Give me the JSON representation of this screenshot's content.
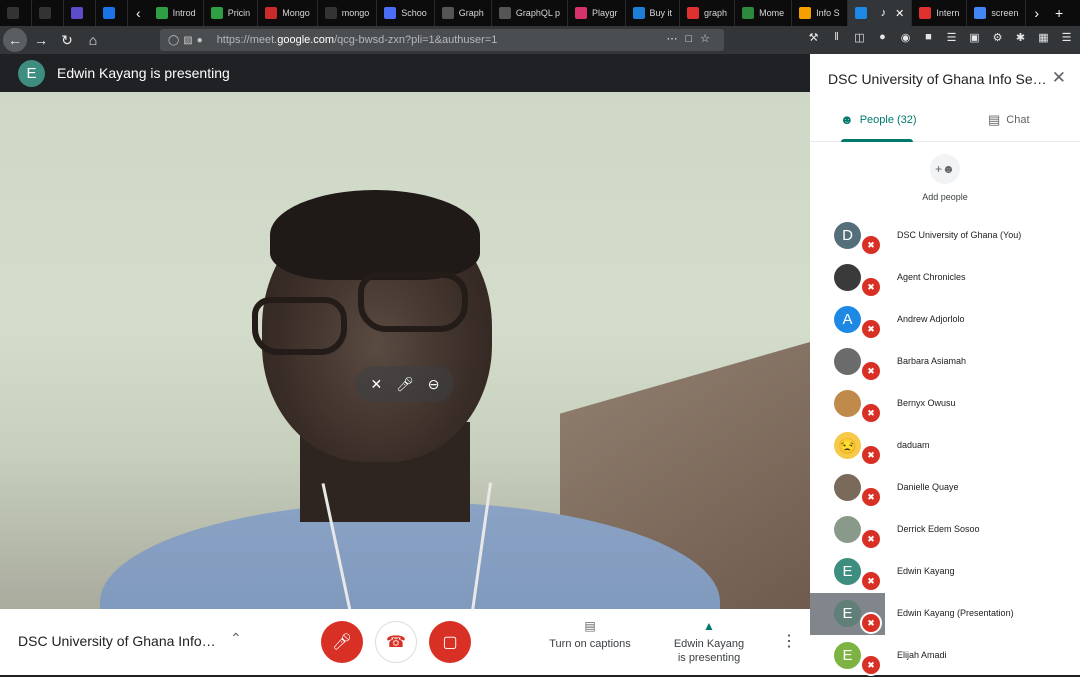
{
  "browser": {
    "tabs": [
      {
        "label": "",
        "color": "#333333",
        "icon": "github-icon"
      },
      {
        "label": "",
        "color": "#333333",
        "icon": "warning-icon"
      },
      {
        "label": "",
        "color": "#5b4dc7",
        "icon": "app-icon"
      },
      {
        "label": "",
        "color": "#1a73e8",
        "icon": "dash-icon"
      },
      {
        "label": "Introd",
        "color": "#2f9e44",
        "icon": "n-icon"
      },
      {
        "label": "Pricin",
        "color": "#2f9e44",
        "icon": "leaf-icon"
      },
      {
        "label": "Mongo",
        "color": "#c92a2a",
        "icon": "m-icon"
      },
      {
        "label": "mongo",
        "color": "#333333",
        "icon": "github-icon"
      },
      {
        "label": "Schoo",
        "color": "#4c6ef5",
        "icon": "school-icon"
      },
      {
        "label": "Graph",
        "color": "#555555",
        "icon": "prisma-icon"
      },
      {
        "label": "GraphQL p",
        "color": "#555555",
        "icon": "blank-icon"
      },
      {
        "label": "Playgr",
        "color": "#d6336c",
        "icon": "playground-icon"
      },
      {
        "label": "Buy it",
        "color": "#1c7ed6",
        "icon": "zoom-icon"
      },
      {
        "label": "graph",
        "color": "#e03131",
        "icon": "n-icon"
      },
      {
        "label": "Mome",
        "color": "#2b8a3e",
        "icon": "clock-icon"
      },
      {
        "label": "Info S",
        "color": "#f59f00",
        "icon": "mail-icon"
      },
      {
        "label": "",
        "color": "#1e88e5",
        "icon": "meet-icon"
      },
      {
        "label": "Intern",
        "color": "#e03131",
        "icon": "speed-icon"
      },
      {
        "label": "screen",
        "color": "#4285f4",
        "icon": "google-icon"
      }
    ],
    "url_prefix": "https://meet.",
    "url_host": "google.com",
    "url_path": "/qcg-bwsd-zxn?pli=1&authuser=1"
  },
  "presenter": {
    "initial": "E",
    "text": "Edwin Kayang is presenting"
  },
  "bottom": {
    "meeting_title": "DSC University of Ghana Info S...",
    "captions_label": "Turn on captions",
    "presenting_line1": "Edwin Kayang",
    "presenting_line2": "is presenting"
  },
  "panel": {
    "title": "DSC University of Ghana Info Ses...",
    "people_tab": "People (32)",
    "chat_tab": "Chat",
    "add_people": "Add people",
    "participants": [
      {
        "name": "DSC University of Ghana (You)",
        "initial": "D",
        "color": "#546e7a"
      },
      {
        "name": "Agent Chronicles",
        "initial": "",
        "color": "#3a3a3a"
      },
      {
        "name": "Andrew Adjorlolo",
        "initial": "A",
        "color": "#1e88e5"
      },
      {
        "name": "Barbara Asiamah",
        "initial": "",
        "color": "#6b6b6b"
      },
      {
        "name": "Bernyx Owusu",
        "initial": "",
        "color": "#c08a4a"
      },
      {
        "name": "daduam",
        "initial": "😒",
        "color": "#f7c948"
      },
      {
        "name": "Danielle Quaye",
        "initial": "",
        "color": "#7a6a5a"
      },
      {
        "name": "Derrick Edem Sosoo",
        "initial": "",
        "color": "#8a9a8a"
      },
      {
        "name": "Edwin Kayang",
        "initial": "E",
        "color": "#3e8e80"
      },
      {
        "name": "Edwin Kayang (Presentation)",
        "initial": "E",
        "color": "#5f7f78"
      },
      {
        "name": "Elijah Amadi",
        "initial": "E",
        "color": "#7cb342"
      }
    ]
  }
}
